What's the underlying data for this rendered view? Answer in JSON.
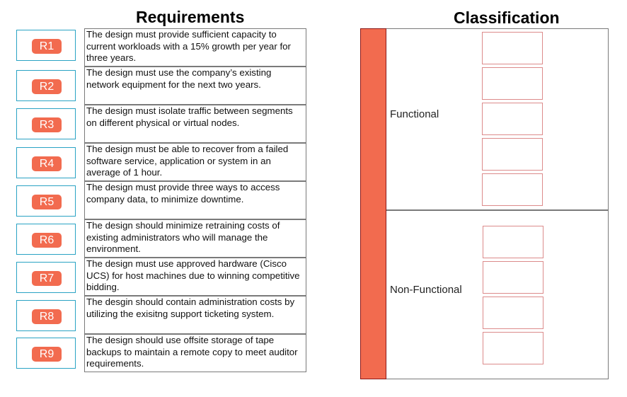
{
  "requirements": {
    "title": "Requirements",
    "items": [
      {
        "id": "R1",
        "text": "The design must provide sufficient capacity to current workloads with a 15% growth per year for three years."
      },
      {
        "id": "R2",
        "text": "The design must use the company’s existing network equipment for the next two years."
      },
      {
        "id": "R3",
        "text": "The design must isolate traffic between segments on different physical or virtual nodes."
      },
      {
        "id": "R4",
        "text": "The design must be able to recover from a failed software service, application or system in an average of 1 hour."
      },
      {
        "id": "R5",
        "text": "The design must provide three ways to access company data, to minimize downtime."
      },
      {
        "id": "R6",
        "text": "The design should minimize retraining costs of existing administrators who will manage the environment."
      },
      {
        "id": "R7",
        "text": "The design must use approved hardware (Cisco UCS) for host machines due to winning competitive bidding."
      },
      {
        "id": "R8",
        "text": "The desgin should contain administration costs by utilizing the exisitng support ticketing system."
      },
      {
        "id": "R9",
        "text": "The design should use offsite storage of tape backups to maintain a remote copy to meet auditor requirements."
      }
    ]
  },
  "classification": {
    "title": "Classification",
    "categories": [
      {
        "label": "Functional",
        "slot_count": 5
      },
      {
        "label": "Non-Functional",
        "slot_count": 4
      }
    ]
  },
  "colors": {
    "badge": "#f26b4f",
    "tile_border": "#2aa3c4",
    "slot_border": "#dc8b8b",
    "strip": "#f26b4f"
  }
}
